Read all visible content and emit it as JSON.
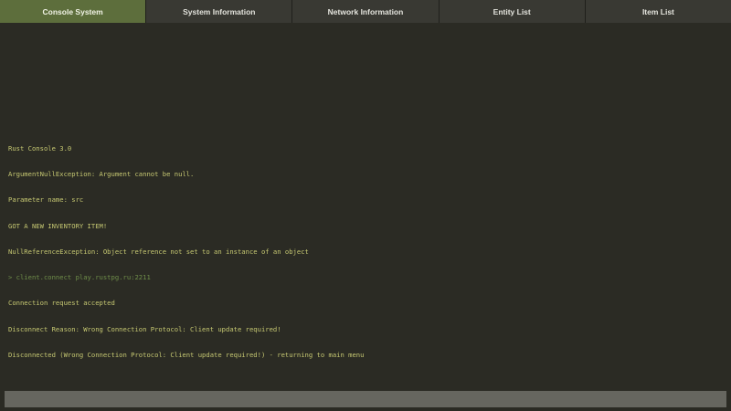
{
  "tabs": [
    {
      "label": "Console System",
      "active": true
    },
    {
      "label": "System Information",
      "active": false
    },
    {
      "label": "Network Information",
      "active": false
    },
    {
      "label": "Entity List",
      "active": false
    },
    {
      "label": "Item List",
      "active": false
    }
  ],
  "console": {
    "lines": [
      {
        "text": "Rust Console 3.0",
        "color": "#c6c872"
      },
      {
        "text": "ArgumentNullException: Argument cannot be null.",
        "color": "#c6c872"
      },
      {
        "text": "Parameter name: src",
        "color": "#c6c872"
      },
      {
        "text": "GOT A NEW INVENTORY ITEM!",
        "color": "#c6c872"
      },
      {
        "text": "NullReferenceException: Object reference not set to an instance of an object",
        "color": "#c6c872"
      },
      {
        "text": "> client.connect play.rustpg.ru:2211",
        "color": "#6f8e4a"
      },
      {
        "text": "Connection request accepted",
        "color": "#c6c872"
      },
      {
        "text": "Disconnect Reason: Wrong Connection Protocol: Client update required!",
        "color": "#c6c872"
      },
      {
        "text": "Disconnected (Wrong Connection Protocol: Client update required!) - returning to main menu",
        "color": "#c6c872"
      }
    ],
    "input_value": ""
  },
  "colors": {
    "background": "#2b2b24",
    "tab_active": "#5d6e3c",
    "tab_inactive": "#393933",
    "input_bar": "#66665f"
  }
}
